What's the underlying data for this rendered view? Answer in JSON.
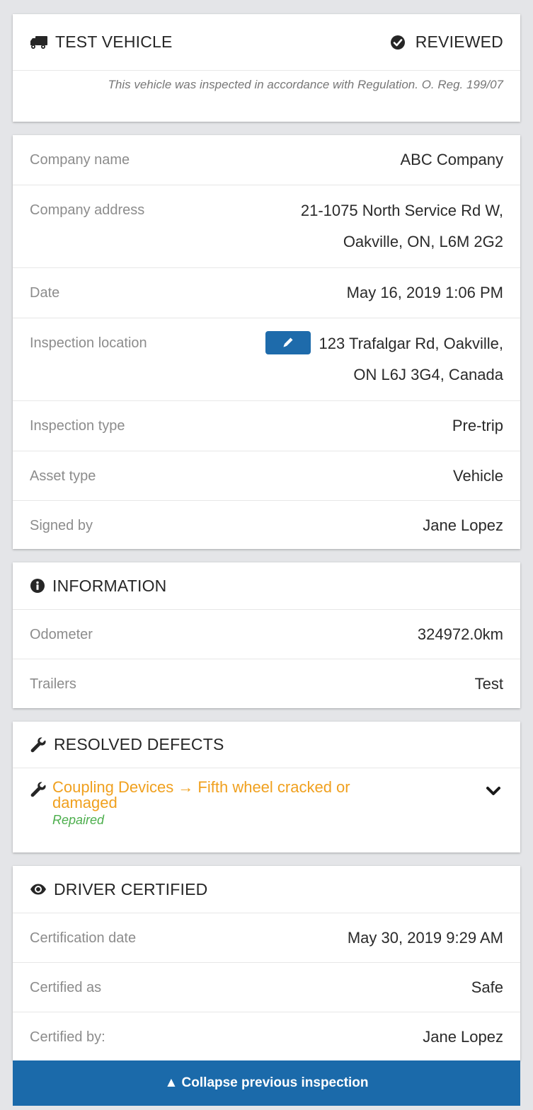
{
  "vehicle": {
    "title": "TEST VEHICLE",
    "status": "REVIEWED",
    "regulation_note": "This vehicle was inspected in accordance with Regulation. O. Reg. 199/07"
  },
  "details": {
    "company_name_label": "Company name",
    "company_name": "ABC Company",
    "company_address_label": "Company address",
    "company_address_line1": "21-1075 North Service Rd W,",
    "company_address_line2": "Oakville, ON, L6M 2G2",
    "date_label": "Date",
    "date": "May 16, 2019 1:06 PM",
    "location_label": "Inspection location",
    "location_line1": "123 Trafalgar Rd, Oakville,",
    "location_line2": "ON L6J 3G4, Canada",
    "inspection_type_label": "Inspection type",
    "inspection_type": "Pre-trip",
    "asset_type_label": "Asset type",
    "asset_type": "Vehicle",
    "signed_by_label": "Signed by",
    "signed_by": "Jane Lopez"
  },
  "information": {
    "title": "INFORMATION",
    "odometer_label": "Odometer",
    "odometer": "324972.0km",
    "trailers_label": "Trailers",
    "trailers": "Test"
  },
  "defects": {
    "title": "RESOLVED DEFECTS",
    "items": [
      {
        "title_line1": "Coupling Devices → Fifth wheel cracked or",
        "title_line2": "damaged",
        "status": "Repaired"
      }
    ]
  },
  "certification": {
    "title": "DRIVER CERTIFIED",
    "date_label": "Certification date",
    "date": "May 30, 2019 9:29 AM",
    "certified_as_label": "Certified as",
    "certified_as": "Safe",
    "certified_by_label": "Certified by:",
    "certified_by": "Jane Lopez"
  },
  "footer": {
    "collapse_label": "▲ Collapse previous inspection"
  },
  "colors": {
    "accent_blue": "#1b6aaa",
    "defect_orange": "#f0a01e",
    "repaired_green": "#4cae4c"
  }
}
